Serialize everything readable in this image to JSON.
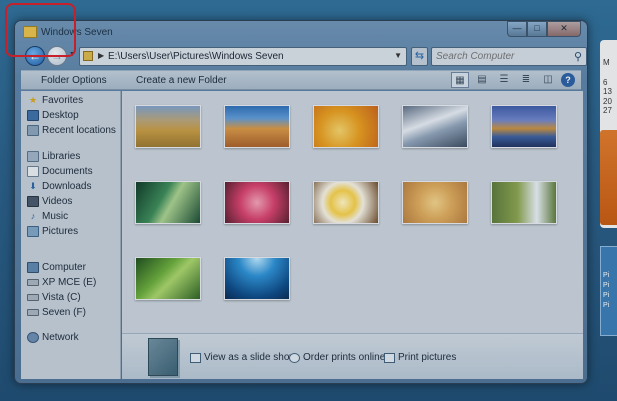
{
  "window": {
    "title": "Windows Seven",
    "minimize_symbol": "—",
    "maximize_symbol": "□",
    "close_symbol": "✕"
  },
  "nav": {
    "back_symbol": "←",
    "forward_symbol": "→",
    "address": "E:\\Users\\User\\Pictures\\Windows Seven",
    "search_placeholder": "Search Computer"
  },
  "commands": {
    "folder_options": "Folder Options",
    "new_folder": "Create a new Folder"
  },
  "sidebar": {
    "favorites": [
      {
        "label": "Favorites",
        "icon": "star-icon"
      },
      {
        "label": "Desktop",
        "icon": "desktop-icon"
      },
      {
        "label": "Recent locations",
        "icon": "recent-icon"
      }
    ],
    "libraries": [
      {
        "label": "Libraries",
        "icon": "library-icon"
      },
      {
        "label": "Documents",
        "icon": "documents-icon"
      },
      {
        "label": "Downloads",
        "icon": "downloads-icon"
      },
      {
        "label": "Videos",
        "icon": "videos-icon"
      },
      {
        "label": "Music",
        "icon": "music-icon"
      },
      {
        "label": "Pictures",
        "icon": "pictures-icon"
      }
    ],
    "computer": [
      {
        "label": "Computer",
        "icon": "computer-icon"
      },
      {
        "label": "XP MCE (E)",
        "icon": "drive-icon"
      },
      {
        "label": "Vista (C)",
        "icon": "drive-icon"
      },
      {
        "label": "Seven (F)",
        "icon": "drive-icon"
      }
    ],
    "network": [
      {
        "label": "Network",
        "icon": "network-icon"
      }
    ]
  },
  "details": {
    "slideshow": "View as a slide show",
    "order_prints": "Order prints online",
    "print": "Print pictures"
  },
  "desktop": {
    "calendar_days": [
      "M",
      "6",
      "13",
      "20",
      "27"
    ],
    "gadget_list": [
      "Pi",
      "Pi",
      "Pi",
      "Pi"
    ]
  },
  "colors": {
    "accent": "#2b5fa3",
    "highlight": "#d4202a"
  }
}
